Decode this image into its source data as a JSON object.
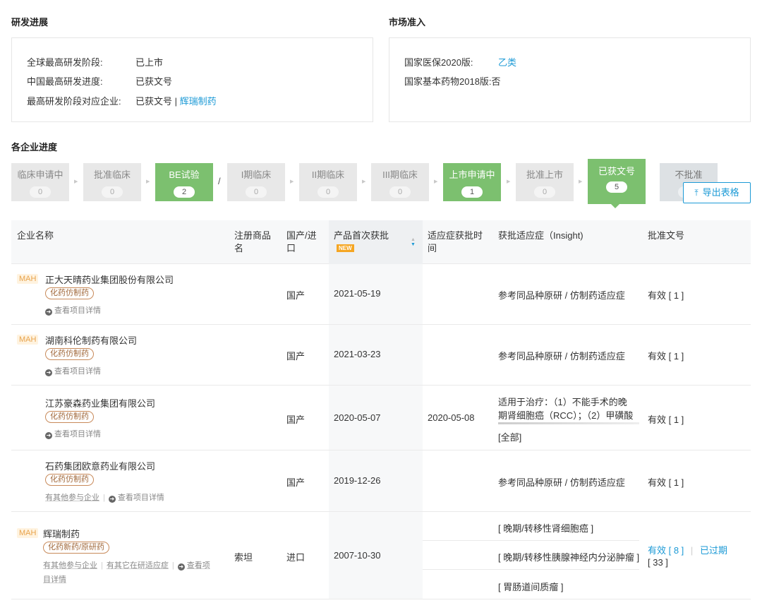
{
  "rd": {
    "title": "研发进展",
    "items": [
      {
        "key": "全球最高研发阶段:",
        "value": "已上市"
      },
      {
        "key": "中国最高研发进度:",
        "value": "已获文号"
      },
      {
        "key": "最高研发阶段对应企业:",
        "value": "已获文号",
        "sep": " | ",
        "link": "辉瑞制药"
      }
    ]
  },
  "market": {
    "title": "市场准入",
    "items": [
      {
        "key": "国家医保2020版:",
        "value": "乙类"
      },
      {
        "key": "国家基本药物2018版:",
        "value": "否"
      }
    ]
  },
  "progress": {
    "title": "各企业进度",
    "stages": [
      {
        "label": "临床申请中",
        "count": "0"
      },
      {
        "label": "批准临床",
        "count": "0"
      },
      {
        "label": "BE试验",
        "count": "2"
      },
      {
        "label": "I期临床",
        "count": "0"
      },
      {
        "label": "II期临床",
        "count": "0"
      },
      {
        "label": "III期临床",
        "count": "0"
      },
      {
        "label": "上市申请中",
        "count": "1"
      },
      {
        "label": "批准上市",
        "count": "0"
      },
      {
        "label": "已获文号",
        "count": "5"
      },
      {
        "label": "不批准",
        "count": ""
      }
    ],
    "slash": "/",
    "export_label": "导出表格",
    "export_icon": "upload-icon"
  },
  "table": {
    "headers": {
      "company": "企业名称",
      "brand": "注册商品名",
      "origin": "国产/进口",
      "first_approval": "产品首次获批",
      "new_badge": "NEW",
      "indication_time": "适应症获批时间",
      "indication": "获批适应症（Insight)",
      "approval_no": "批准文号"
    },
    "rows": [
      {
        "mah": "MAH",
        "company": "正大天晴药业集团股份有限公司",
        "tag": "化药仿制药",
        "links": [
          "查看项目详情"
        ],
        "brand": "",
        "origin": "国产",
        "date": "2021-05-19",
        "indication_time": "",
        "indication": "参考同品种原研 / 仿制药适应症",
        "approval": "有效 [ 1 ]"
      },
      {
        "mah": "MAH",
        "company": "湖南科伦制药有限公司",
        "tag": "化药仿制药",
        "links": [
          "查看项目详情"
        ],
        "brand": "",
        "origin": "国产",
        "date": "2021-03-23",
        "indication_time": "",
        "indication": "参考同品种原研 / 仿制药适应症",
        "approval": "有效 [ 1 ]"
      },
      {
        "mah": "",
        "company": "江苏豪森药业集团有限公司",
        "tag": "化药仿制药",
        "links": [
          "查看项目详情"
        ],
        "brand": "",
        "origin": "国产",
        "date": "2020-05-07",
        "indication_time": "2020-05-08",
        "indication_l1": "适用于治疗：（1）不能手术的晚",
        "indication_l2": "期肾细胞癌（RCC）；（2）甲磺酸",
        "indication_more": "[全部]",
        "approval": "有效 [ 1 ]"
      },
      {
        "mah": "",
        "company": "石药集团欧意药业有限公司",
        "tag": "化药仿制药",
        "links": [
          "有其他参与企业",
          "查看项目详情"
        ],
        "brand": "",
        "origin": "国产",
        "date": "2019-12-26",
        "indication_time": "",
        "indication": "参考同品种原研 / 仿制药适应症",
        "approval": "有效 [ 1 ]"
      },
      {
        "mah": "MAH",
        "company": "辉瑞制药",
        "tag": "化药新药/原研药",
        "links": [
          "有其他参与企业",
          "有其它在研适应症",
          "查看项",
          "目详情"
        ],
        "brand": "索坦",
        "origin": "进口",
        "date": "2007-10-30",
        "indication_time": "",
        "indications": [
          "[ 晚期/转移性肾细胞癌 ]",
          "[ 晚期/转移性胰腺神经内分泌肿瘤 ]",
          "[ 胃肠道间质瘤 ]"
        ],
        "approval_valid": "有效 [ 8 ]",
        "approval_sep": "|",
        "approval_expired": "已过期",
        "approval_expired_count": "[ 33 ]"
      }
    ]
  }
}
